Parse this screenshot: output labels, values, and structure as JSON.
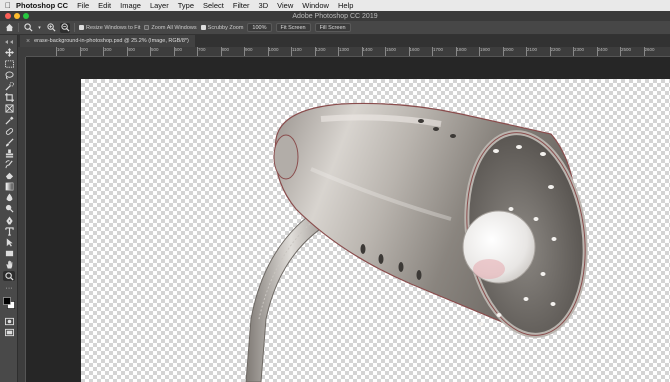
{
  "menubar": {
    "app_name": "Photoshop CC",
    "items": [
      "File",
      "Edit",
      "Image",
      "Layer",
      "Type",
      "Select",
      "Filter",
      "3D",
      "View",
      "Window",
      "Help"
    ]
  },
  "window": {
    "title": "Adobe Photoshop CC 2019"
  },
  "options": {
    "resize_windows": "Resize Windows to Fit",
    "zoom_all_windows": "Zoom All Windows",
    "scrubby_zoom": "Scrubby Zoom",
    "percent_button": "100%",
    "fit_screen": "Fit Screen",
    "fill_screen": "Fill Screen"
  },
  "document": {
    "tab_label": "erase-background-in-photoshop.psd @ 25.2% (Image, RGB/8*)"
  },
  "ruler": {
    "labels": [
      "100",
      "200",
      "300",
      "400",
      "500",
      "600",
      "700",
      "800",
      "900",
      "1000",
      "1100",
      "1200",
      "1300",
      "1400",
      "1500",
      "1600",
      "1700",
      "1800",
      "1900",
      "2000",
      "2100",
      "2200",
      "2300",
      "2400",
      "2500",
      "2600"
    ]
  },
  "colors": {
    "accent": "#4a90d9",
    "traffic_close": "#fc5f57",
    "traffic_min": "#fdbc2e",
    "traffic_max": "#28c840"
  }
}
